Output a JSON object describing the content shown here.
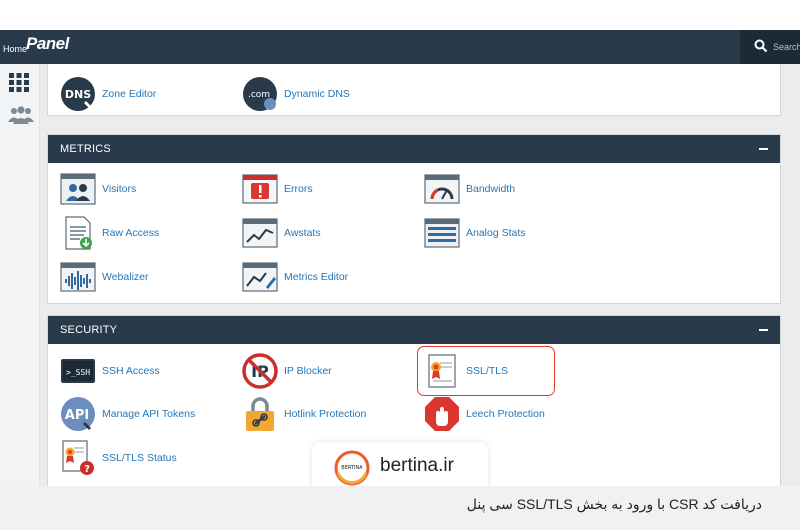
{
  "topbar": {
    "home_label": "Home",
    "logo_text": "Panel",
    "search_placeholder": "Search"
  },
  "left_rail": {
    "items": [
      {
        "name": "apps-grid",
        "icon": "grid-icon"
      },
      {
        "name": "users",
        "icon": "users-icon"
      }
    ]
  },
  "domains_partial": {
    "items": [
      {
        "label": "Zone Editor",
        "icon": "dns-icon"
      },
      {
        "label": "Dynamic DNS",
        "icon": "dynamic-dns-icon"
      }
    ]
  },
  "metrics": {
    "title": "METRICS",
    "items": [
      {
        "label": "Visitors",
        "icon": "visitors-icon"
      },
      {
        "label": "Errors",
        "icon": "errors-icon"
      },
      {
        "label": "Bandwidth",
        "icon": "bandwidth-icon"
      },
      {
        "label": "Raw Access",
        "icon": "raw-access-icon"
      },
      {
        "label": "Awstats",
        "icon": "awstats-icon"
      },
      {
        "label": "Analog Stats",
        "icon": "analog-stats-icon"
      },
      {
        "label": "Webalizer",
        "icon": "webalizer-icon"
      },
      {
        "label": "Metrics Editor",
        "icon": "metrics-editor-icon"
      }
    ]
  },
  "security": {
    "title": "SECURITY",
    "items": [
      {
        "label": "SSH Access",
        "icon": "ssh-icon"
      },
      {
        "label": "IP Blocker",
        "icon": "ip-blocker-icon"
      },
      {
        "label": "SSL/TLS",
        "icon": "ssl-tls-icon"
      },
      {
        "label": "Manage API Tokens",
        "icon": "api-icon"
      },
      {
        "label": "Hotlink Protection",
        "icon": "hotlink-icon"
      },
      {
        "label": "Leech Protection",
        "icon": "leech-icon"
      },
      {
        "label": "SSL/TLS Status",
        "icon": "ssl-status-icon"
      }
    ]
  },
  "watermark": {
    "text": "bertina.ir",
    "badge_text": "BERTINA"
  },
  "caption": {
    "text": "دریافت کد CSR با ورود به بخش SSL/TLS سی پنل"
  },
  "colors": {
    "header_bg": "#293a4a",
    "link": "#2576b5",
    "highlight": "#e0392b",
    "accent_orange": "#f0592a"
  }
}
